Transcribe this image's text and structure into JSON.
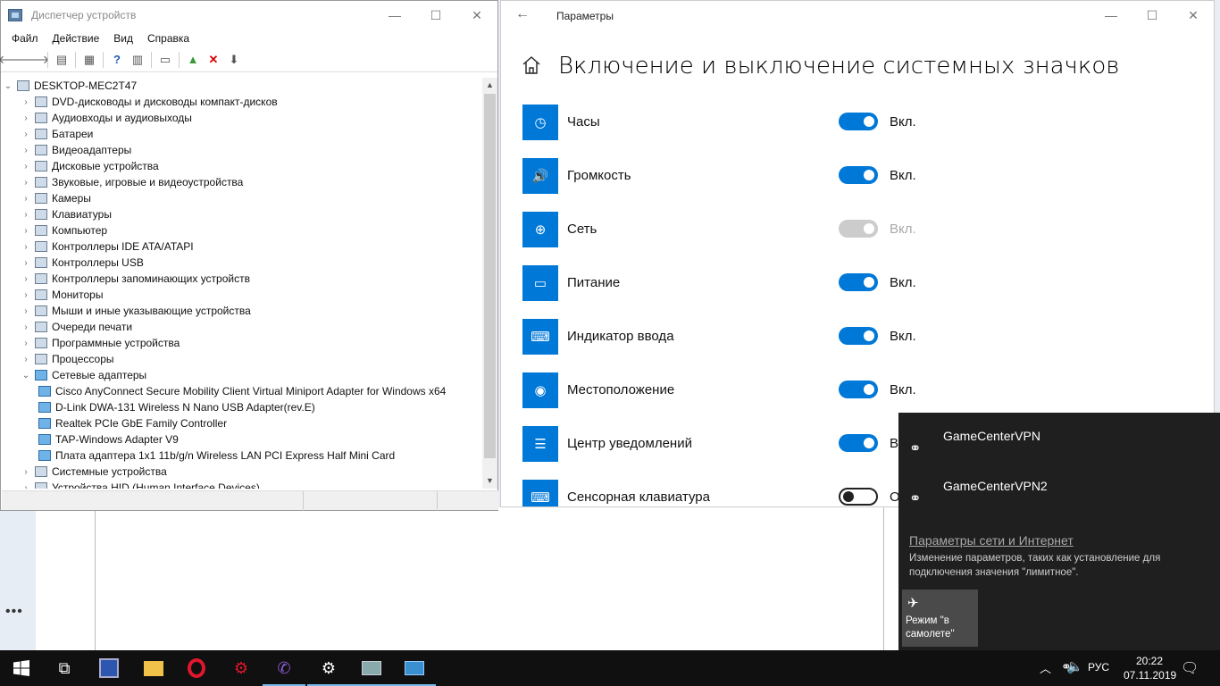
{
  "device_manager": {
    "title": "Диспетчер устройств",
    "menu": [
      "Файл",
      "Действие",
      "Вид",
      "Справка"
    ],
    "root": "DESKTOP-MEC2T47",
    "tree": [
      {
        "label": "DVD-дисководы и дисководы компакт-дисков",
        "expanded": false
      },
      {
        "label": "Аудиовходы и аудиовыходы",
        "expanded": false
      },
      {
        "label": "Батареи",
        "expanded": false
      },
      {
        "label": "Видеоадаптеры",
        "expanded": false
      },
      {
        "label": "Дисковые устройства",
        "expanded": false
      },
      {
        "label": "Звуковые, игровые и видеоустройства",
        "expanded": false
      },
      {
        "label": "Камеры",
        "expanded": false
      },
      {
        "label": "Клавиатуры",
        "expanded": false
      },
      {
        "label": "Компьютер",
        "expanded": false
      },
      {
        "label": "Контроллеры IDE ATA/ATAPI",
        "expanded": false
      },
      {
        "label": "Контроллеры USB",
        "expanded": false
      },
      {
        "label": "Контроллеры запоминающих устройств",
        "expanded": false
      },
      {
        "label": "Мониторы",
        "expanded": false
      },
      {
        "label": "Мыши и иные указывающие устройства",
        "expanded": false
      },
      {
        "label": "Очереди печати",
        "expanded": false
      },
      {
        "label": "Программные устройства",
        "expanded": false
      },
      {
        "label": "Процессоры",
        "expanded": false
      },
      {
        "label": "Сетевые адаптеры",
        "expanded": true
      },
      {
        "label": "Cisco AnyConnect Secure Mobility Client Virtual Miniport Adapter for Windows x64",
        "child": true
      },
      {
        "label": "D-Link DWA-131 Wireless N Nano USB Adapter(rev.E)",
        "child": true
      },
      {
        "label": "Realtek PCIe GbE Family Controller",
        "child": true
      },
      {
        "label": "TAP-Windows Adapter V9",
        "child": true
      },
      {
        "label": "Плата адаптера 1x1 11b/g/n Wireless LAN PCI Express Half Mini Card",
        "child": true
      },
      {
        "label": "Системные устройства",
        "expanded": false
      },
      {
        "label": "Устройства HID (Human Interface Devices)",
        "expanded": false
      }
    ]
  },
  "settings": {
    "title": "Параметры",
    "heading": "Включение и выключение системных значков",
    "items": [
      {
        "label": "Часы",
        "state": "Вкл.",
        "toggle": "on",
        "icon": "clock-icon"
      },
      {
        "label": "Громкость",
        "state": "Вкл.",
        "toggle": "on",
        "icon": "volume-icon"
      },
      {
        "label": "Сеть",
        "state": "Вкл.",
        "toggle": "disabled",
        "icon": "globe-icon"
      },
      {
        "label": "Питание",
        "state": "Вкл.",
        "toggle": "on",
        "icon": "battery-icon"
      },
      {
        "label": "Индикатор ввода",
        "state": "Вкл.",
        "toggle": "on",
        "icon": "keyboard-icon"
      },
      {
        "label": "Местоположение",
        "state": "Вкл.",
        "toggle": "on",
        "icon": "location-icon"
      },
      {
        "label": "Центр уведомлений",
        "state": "Вк",
        "toggle": "on",
        "icon": "notification-icon"
      },
      {
        "label": "Сенсорная клавиатура",
        "state": "О",
        "toggle": "off",
        "icon": "touch-keyboard-icon"
      }
    ]
  },
  "network_flyout": {
    "vpns": [
      "GameCenterVPN",
      "GameCenterVPN2"
    ],
    "settings_link": "Параметры сети и Интернет",
    "settings_desc": "Изменение параметров, таких как установление для подключения значения \"лимитное\".",
    "airplane_label": "Режим \"в самолете\""
  },
  "taskbar": {
    "lang": "РУС",
    "time": "20:22",
    "date": "07.11.2019"
  },
  "colors": {
    "accent": "#0078d7",
    "flyout_bg": "#1f1f1f",
    "taskbar_bg": "#101010"
  }
}
